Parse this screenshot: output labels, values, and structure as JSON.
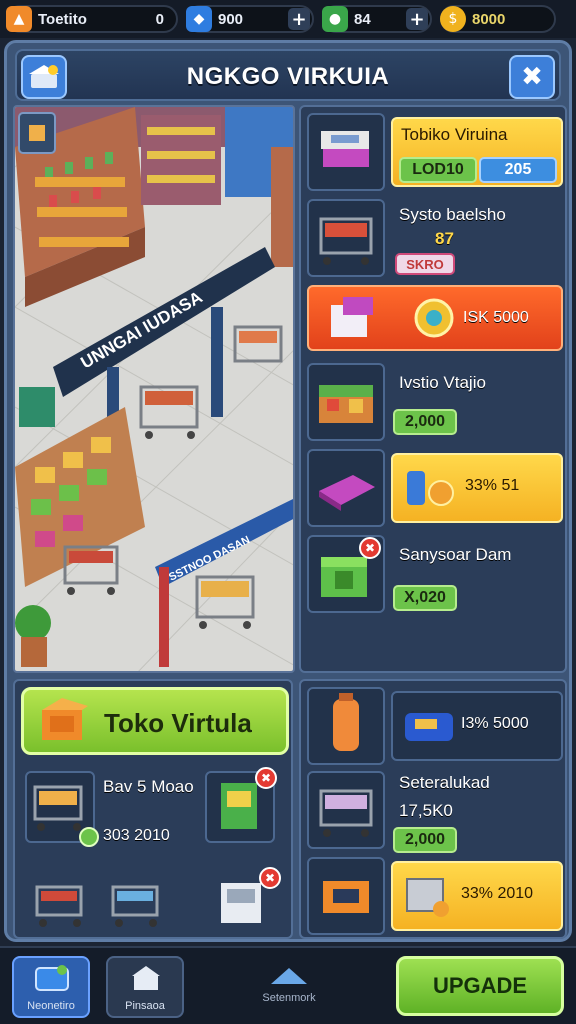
{
  "topbar": {
    "player": {
      "name": "Toetito",
      "value": "0",
      "icon": "profile-icon"
    },
    "gems": {
      "value": "900",
      "icon": "gem-icon"
    },
    "energy": {
      "value": "84",
      "icon": "energy-icon"
    },
    "coins": {
      "value": "8000",
      "icon": "coin-icon"
    }
  },
  "header": {
    "title": "NGKGO VIRKUIA",
    "left_icon": "store-icon",
    "close_icon": "close-icon"
  },
  "scene": {
    "banner_main": "UNNGAI IUDASA",
    "banner_bottom": "SSTNOO DASAN"
  },
  "items": [
    {
      "name": "Tobiko Viruina",
      "price": "LOD10",
      "secondary": "205"
    },
    {
      "name": "Systo baelsho",
      "value": "87",
      "price": "SKRO"
    },
    {
      "name": "",
      "price": "ISK 5000"
    },
    {
      "name": "Ivstio Vtajio",
      "price": "2,000"
    },
    {
      "name": "",
      "price": "33% 51"
    },
    {
      "name": "Sanysoar Dam",
      "price": "X,020"
    }
  ],
  "bottom_left": {
    "button_label": "Toko Virtula",
    "item1_name": "Bav 5 Moao",
    "item1_price": "303 2010"
  },
  "bottom_right": [
    {
      "name": "",
      "price": "I3% 5000"
    },
    {
      "name": "Seteralukad",
      "value": "17,5K0",
      "price": "2,000"
    },
    {
      "name": "",
      "price": "33% 2010"
    }
  ],
  "nav": {
    "btn1": "Neonetiro",
    "btn2": "Pinsaoa",
    "btn3": "Setenmork",
    "upgrade": "UPGADE"
  }
}
